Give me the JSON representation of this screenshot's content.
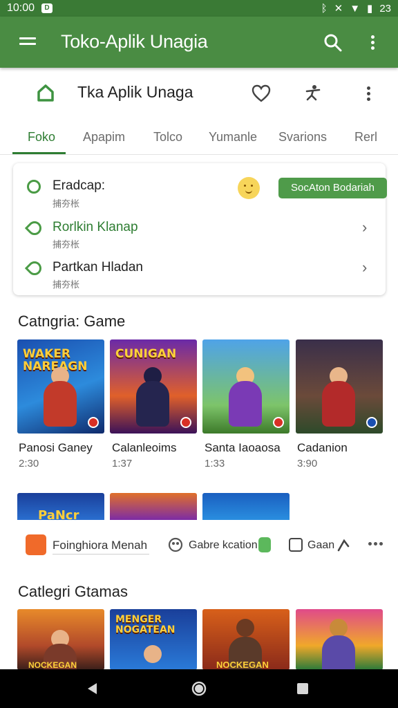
{
  "status_bar": {
    "time": "10:00",
    "sim_icon": "D",
    "battery": "23",
    "icons": [
      "bluetooth-icon",
      "mute-icon",
      "wifi-icon",
      "battery-icon"
    ]
  },
  "app_bar": {
    "title": "Toko-Aplik Unagia",
    "icons": [
      "menu-icon",
      "search-icon",
      "more-vert-icon"
    ]
  },
  "sub_bar": {
    "title": "Tka Aplik Unaga",
    "icons": [
      "home-icon",
      "heart-icon",
      "accessibility-icon",
      "more-vert-icon"
    ]
  },
  "tabs": [
    {
      "label": "Foko",
      "active": true
    },
    {
      "label": "Apapim"
    },
    {
      "label": "Tolco"
    },
    {
      "label": "Yumanle"
    },
    {
      "label": "Svarions"
    },
    {
      "label": "Rerl"
    }
  ],
  "card": {
    "rows": [
      {
        "title": "Eradcap:",
        "sub": "捕夯枨",
        "button": "SocAton Bodariah"
      },
      {
        "title": "Rorlkin Klanap",
        "sub": "捕夯枨"
      },
      {
        "title": "Partkan Hladan",
        "sub": "捕夯枨"
      }
    ]
  },
  "section1": {
    "title": "Catngria: Game",
    "games": [
      {
        "name": "Panosi Ganey",
        "meta": "2:30",
        "art_title": "WAKER NAREAGN"
      },
      {
        "name": "Calanleoims",
        "meta": "1:37",
        "art_title": "CUNIGAN"
      },
      {
        "name": "Santa Iaoaosa",
        "meta": "1:33",
        "art_title": ""
      },
      {
        "name": "Cadanion",
        "meta": "3:90",
        "art_title": ""
      }
    ],
    "partial_art": [
      "PaNcr",
      "",
      ""
    ]
  },
  "chip_bar": {
    "items": [
      "Foinghiora Menah",
      "Gabre kcation",
      "Gaan"
    ]
  },
  "section2": {
    "title": "Catlegri Gtamas",
    "art": [
      "NOCKEGAN",
      "MENGER NOGATEAN",
      "NOCKEGAN",
      ""
    ]
  },
  "colors": {
    "primary": "#4a8c43",
    "status": "#3a7a35",
    "accent": "#2e7d32"
  }
}
